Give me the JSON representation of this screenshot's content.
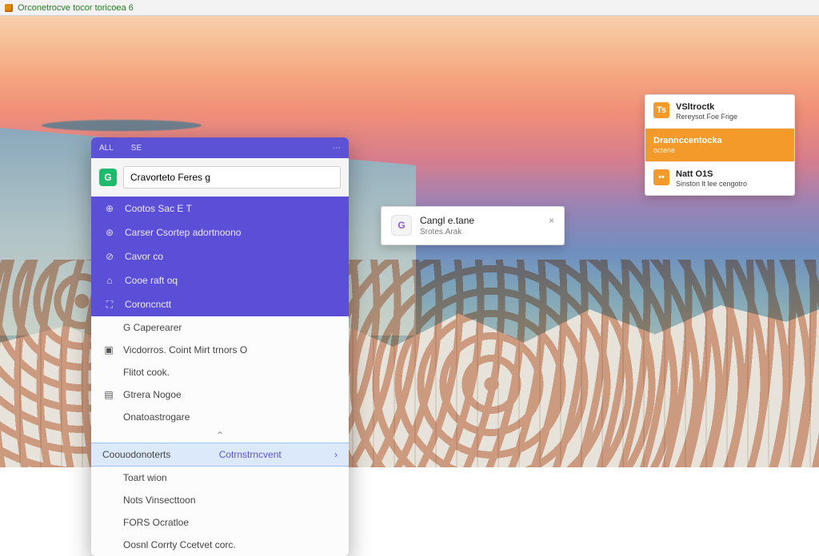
{
  "titlebar": {
    "title": "Orconetrocve tocor toricoea 6"
  },
  "menu": {
    "header": {
      "left": "ALL",
      "mid": "SE",
      "right": "⋯"
    },
    "search": {
      "badge": "G",
      "value": "Cravorteto Feres g"
    },
    "purple": [
      {
        "icon": "⊕",
        "label": "Cootos Sac E T"
      },
      {
        "icon": "⊛",
        "label": "Carser Csortep adortnoono"
      },
      {
        "icon": "⊘",
        "label": "Cavor co"
      },
      {
        "icon": "⌂",
        "label": "Cooe raft oq"
      },
      {
        "icon": "⛶",
        "label": "Coroncnctt"
      }
    ],
    "white": [
      {
        "icon": "",
        "label": "G Caperearer"
      },
      {
        "icon": "▣",
        "label": "Vicdorros. Coint Mirt trnors O"
      },
      {
        "icon": "",
        "label": "Flitot cook."
      },
      {
        "icon": "▤",
        "label": "Gtrera Nogoe"
      },
      {
        "icon": "",
        "label": "Onatoastrogare"
      },
      {
        "icon": "",
        "label": "Coouodonoterts",
        "hl": true,
        "right": "Cotrnstrncvent"
      },
      {
        "icon": "",
        "label": "Toart wion"
      },
      {
        "icon": "",
        "label": "Nots Vinsecttoon"
      },
      {
        "icon": "",
        "label": "FORS Ocratloe"
      },
      {
        "icon": "",
        "label": "Oosnl Corrty Ccetvet corc."
      }
    ]
  },
  "centerCard": {
    "iconText": "G",
    "title": "Cangl e.tane",
    "subtitle": "Srotes.Arak"
  },
  "stack": [
    {
      "iconText": "Ts",
      "title": "VSltroctk",
      "sub": "Rereysot Foe Frige"
    },
    {
      "iconText": "",
      "title": "Drannccentocka",
      "sub": "octene",
      "accent": true
    },
    {
      "iconText": "••",
      "title": "Natt O1S",
      "sub": "Sinston lt lee cengotro"
    }
  ]
}
